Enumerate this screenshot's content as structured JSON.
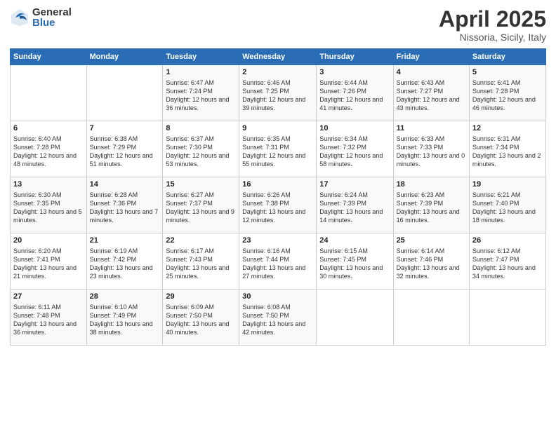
{
  "header": {
    "logo_general": "General",
    "logo_blue": "Blue",
    "month": "April 2025",
    "location": "Nissoria, Sicily, Italy"
  },
  "weekdays": [
    "Sunday",
    "Monday",
    "Tuesday",
    "Wednesday",
    "Thursday",
    "Friday",
    "Saturday"
  ],
  "weeks": [
    [
      {
        "day": "",
        "info": ""
      },
      {
        "day": "",
        "info": ""
      },
      {
        "day": "1",
        "info": "Sunrise: 6:47 AM\nSunset: 7:24 PM\nDaylight: 12 hours and 36 minutes."
      },
      {
        "day": "2",
        "info": "Sunrise: 6:46 AM\nSunset: 7:25 PM\nDaylight: 12 hours and 39 minutes."
      },
      {
        "day": "3",
        "info": "Sunrise: 6:44 AM\nSunset: 7:26 PM\nDaylight: 12 hours and 41 minutes."
      },
      {
        "day": "4",
        "info": "Sunrise: 6:43 AM\nSunset: 7:27 PM\nDaylight: 12 hours and 43 minutes."
      },
      {
        "day": "5",
        "info": "Sunrise: 6:41 AM\nSunset: 7:28 PM\nDaylight: 12 hours and 46 minutes."
      }
    ],
    [
      {
        "day": "6",
        "info": "Sunrise: 6:40 AM\nSunset: 7:28 PM\nDaylight: 12 hours and 48 minutes."
      },
      {
        "day": "7",
        "info": "Sunrise: 6:38 AM\nSunset: 7:29 PM\nDaylight: 12 hours and 51 minutes."
      },
      {
        "day": "8",
        "info": "Sunrise: 6:37 AM\nSunset: 7:30 PM\nDaylight: 12 hours and 53 minutes."
      },
      {
        "day": "9",
        "info": "Sunrise: 6:35 AM\nSunset: 7:31 PM\nDaylight: 12 hours and 55 minutes."
      },
      {
        "day": "10",
        "info": "Sunrise: 6:34 AM\nSunset: 7:32 PM\nDaylight: 12 hours and 58 minutes."
      },
      {
        "day": "11",
        "info": "Sunrise: 6:33 AM\nSunset: 7:33 PM\nDaylight: 13 hours and 0 minutes."
      },
      {
        "day": "12",
        "info": "Sunrise: 6:31 AM\nSunset: 7:34 PM\nDaylight: 13 hours and 2 minutes."
      }
    ],
    [
      {
        "day": "13",
        "info": "Sunrise: 6:30 AM\nSunset: 7:35 PM\nDaylight: 13 hours and 5 minutes."
      },
      {
        "day": "14",
        "info": "Sunrise: 6:28 AM\nSunset: 7:36 PM\nDaylight: 13 hours and 7 minutes."
      },
      {
        "day": "15",
        "info": "Sunrise: 6:27 AM\nSunset: 7:37 PM\nDaylight: 13 hours and 9 minutes."
      },
      {
        "day": "16",
        "info": "Sunrise: 6:26 AM\nSunset: 7:38 PM\nDaylight: 13 hours and 12 minutes."
      },
      {
        "day": "17",
        "info": "Sunrise: 6:24 AM\nSunset: 7:39 PM\nDaylight: 13 hours and 14 minutes."
      },
      {
        "day": "18",
        "info": "Sunrise: 6:23 AM\nSunset: 7:39 PM\nDaylight: 13 hours and 16 minutes."
      },
      {
        "day": "19",
        "info": "Sunrise: 6:21 AM\nSunset: 7:40 PM\nDaylight: 13 hours and 18 minutes."
      }
    ],
    [
      {
        "day": "20",
        "info": "Sunrise: 6:20 AM\nSunset: 7:41 PM\nDaylight: 13 hours and 21 minutes."
      },
      {
        "day": "21",
        "info": "Sunrise: 6:19 AM\nSunset: 7:42 PM\nDaylight: 13 hours and 23 minutes."
      },
      {
        "day": "22",
        "info": "Sunrise: 6:17 AM\nSunset: 7:43 PM\nDaylight: 13 hours and 25 minutes."
      },
      {
        "day": "23",
        "info": "Sunrise: 6:16 AM\nSunset: 7:44 PM\nDaylight: 13 hours and 27 minutes."
      },
      {
        "day": "24",
        "info": "Sunrise: 6:15 AM\nSunset: 7:45 PM\nDaylight: 13 hours and 30 minutes."
      },
      {
        "day": "25",
        "info": "Sunrise: 6:14 AM\nSunset: 7:46 PM\nDaylight: 13 hours and 32 minutes."
      },
      {
        "day": "26",
        "info": "Sunrise: 6:12 AM\nSunset: 7:47 PM\nDaylight: 13 hours and 34 minutes."
      }
    ],
    [
      {
        "day": "27",
        "info": "Sunrise: 6:11 AM\nSunset: 7:48 PM\nDaylight: 13 hours and 36 minutes."
      },
      {
        "day": "28",
        "info": "Sunrise: 6:10 AM\nSunset: 7:49 PM\nDaylight: 13 hours and 38 minutes."
      },
      {
        "day": "29",
        "info": "Sunrise: 6:09 AM\nSunset: 7:50 PM\nDaylight: 13 hours and 40 minutes."
      },
      {
        "day": "30",
        "info": "Sunrise: 6:08 AM\nSunset: 7:50 PM\nDaylight: 13 hours and 42 minutes."
      },
      {
        "day": "",
        "info": ""
      },
      {
        "day": "",
        "info": ""
      },
      {
        "day": "",
        "info": ""
      }
    ]
  ]
}
